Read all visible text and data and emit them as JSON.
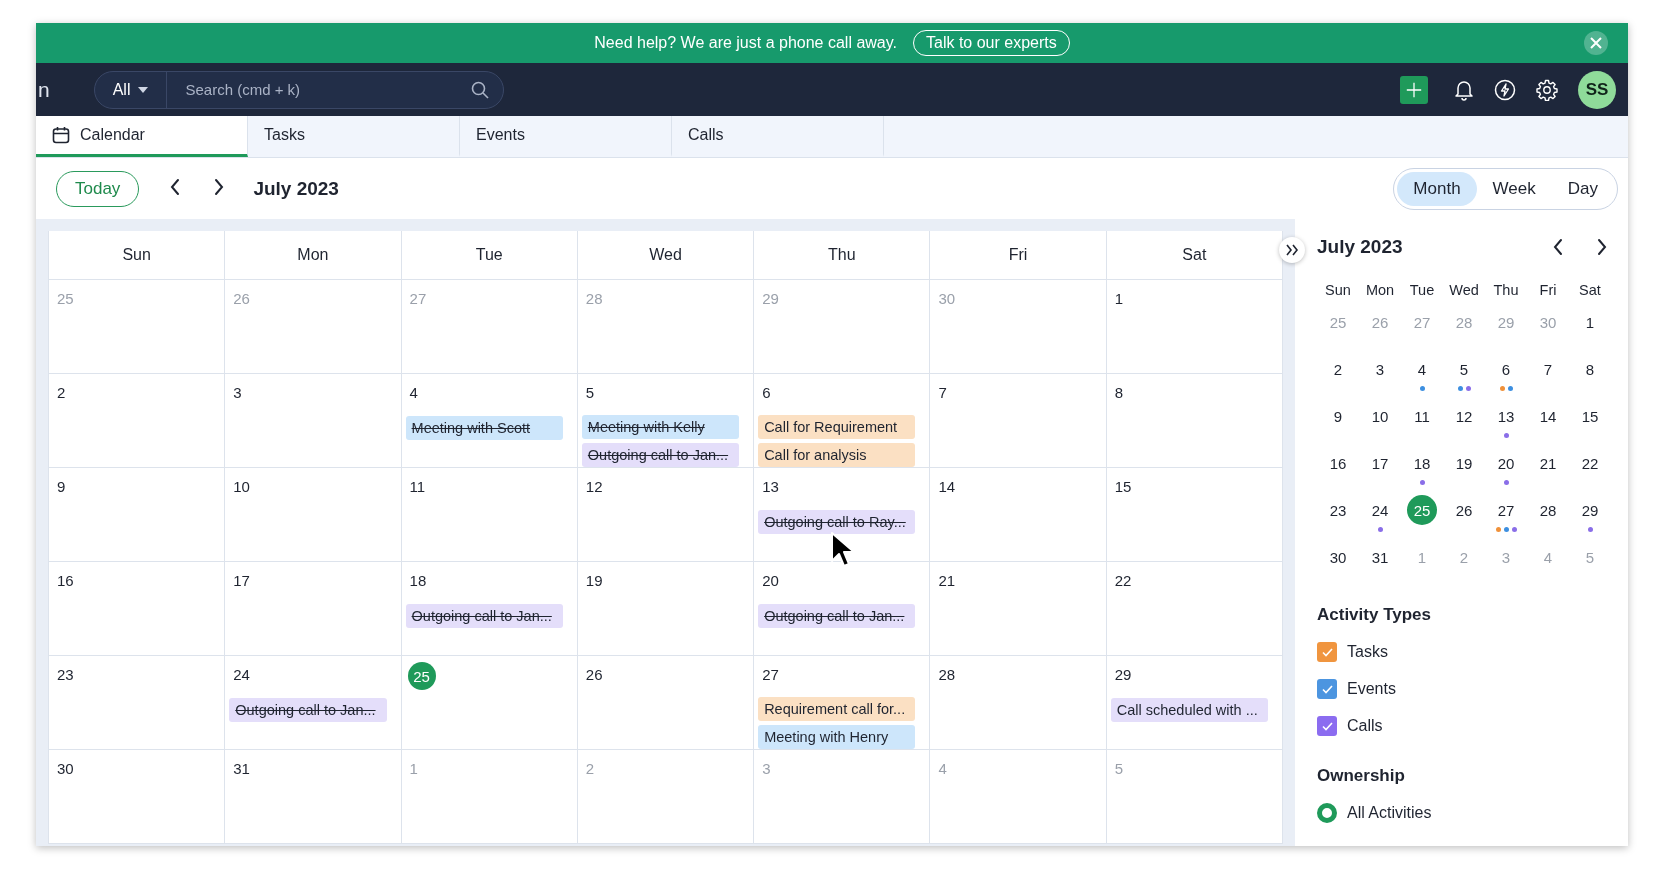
{
  "banner": {
    "message": "Need help? We are just a phone call away.",
    "button": "Talk to our experts"
  },
  "header": {
    "logo_fragment": "n",
    "scope": "All",
    "search": {
      "placeholder": "Search (cmd + k)"
    },
    "avatar": "SS"
  },
  "tabs": [
    {
      "label": "Calendar",
      "selected": true,
      "icon": true
    },
    {
      "label": "Tasks",
      "selected": false
    },
    {
      "label": "Events",
      "selected": false
    },
    {
      "label": "Calls",
      "selected": false
    }
  ],
  "toolbar": {
    "today": "Today",
    "period": "July 2023",
    "views": [
      {
        "label": "Month",
        "selected": true
      },
      {
        "label": "Week",
        "selected": false
      },
      {
        "label": "Day",
        "selected": false
      }
    ]
  },
  "calendar": {
    "weekdays": [
      "Sun",
      "Mon",
      "Tue",
      "Wed",
      "Thu",
      "Fri",
      "Sat"
    ],
    "weeks": [
      [
        {
          "n": "25",
          "muted": true,
          "today": false
        },
        {
          "n": "26",
          "muted": true,
          "today": false
        },
        {
          "n": "27",
          "muted": true,
          "today": false
        },
        {
          "n": "28",
          "muted": true,
          "today": false
        },
        {
          "n": "29",
          "muted": true,
          "today": false
        },
        {
          "n": "30",
          "muted": true,
          "today": false
        },
        {
          "n": "1",
          "muted": false,
          "today": false
        }
      ],
      [
        {
          "n": "2",
          "muted": false,
          "today": false
        },
        {
          "n": "3",
          "muted": false,
          "today": false
        },
        {
          "n": "4",
          "muted": false,
          "today": false,
          "events": [
            {
              "title": "Meeting with Scott",
              "kind": "event",
              "done": true
            }
          ]
        },
        {
          "n": "5",
          "muted": false,
          "today": false,
          "events": [
            {
              "title": "Meeting with Kelly",
              "kind": "event",
              "done": true
            },
            {
              "title": "Outgoing call to Jan...",
              "kind": "call",
              "done": true
            }
          ]
        },
        {
          "n": "6",
          "muted": false,
          "today": false,
          "events": [
            {
              "title": "Call for Requirement",
              "kind": "task",
              "done": false
            },
            {
              "title": "Call for analysis",
              "kind": "task",
              "done": false
            }
          ]
        },
        {
          "n": "7",
          "muted": false,
          "today": false
        },
        {
          "n": "8",
          "muted": false,
          "today": false
        }
      ],
      [
        {
          "n": "9",
          "muted": false,
          "today": false
        },
        {
          "n": "10",
          "muted": false,
          "today": false
        },
        {
          "n": "11",
          "muted": false,
          "today": false
        },
        {
          "n": "12",
          "muted": false,
          "today": false
        },
        {
          "n": "13",
          "muted": false,
          "today": false,
          "events": [
            {
              "title": "Outgoing call to Ray...",
              "kind": "call",
              "done": true
            }
          ]
        },
        {
          "n": "14",
          "muted": false,
          "today": false
        },
        {
          "n": "15",
          "muted": false,
          "today": false
        }
      ],
      [
        {
          "n": "16",
          "muted": false,
          "today": false
        },
        {
          "n": "17",
          "muted": false,
          "today": false
        },
        {
          "n": "18",
          "muted": false,
          "today": false,
          "events": [
            {
              "title": "Outgoing call to Jan...",
              "kind": "call",
              "done": true
            }
          ]
        },
        {
          "n": "19",
          "muted": false,
          "today": false
        },
        {
          "n": "20",
          "muted": false,
          "today": false,
          "events": [
            {
              "title": "Outgoing call to Jan...",
              "kind": "call",
              "done": true
            }
          ]
        },
        {
          "n": "21",
          "muted": false,
          "today": false
        },
        {
          "n": "22",
          "muted": false,
          "today": false
        }
      ],
      [
        {
          "n": "23",
          "muted": false,
          "today": false
        },
        {
          "n": "24",
          "muted": false,
          "today": false,
          "events": [
            {
              "title": "Outgoing call to Jan...",
              "kind": "call",
              "done": true
            }
          ]
        },
        {
          "n": "25",
          "muted": false,
          "today": true
        },
        {
          "n": "26",
          "muted": false,
          "today": false
        },
        {
          "n": "27",
          "muted": false,
          "today": false,
          "events": [
            {
              "title": "Requirement call for...",
              "kind": "task",
              "done": false
            },
            {
              "title": "Meeting with Henry",
              "kind": "event",
              "done": false
            }
          ]
        },
        {
          "n": "28",
          "muted": false,
          "today": false
        },
        {
          "n": "29",
          "muted": false,
          "today": false,
          "events": [
            {
              "title": "Call scheduled with ...",
              "kind": "call",
              "done": false
            }
          ]
        }
      ],
      [
        {
          "n": "30",
          "muted": false,
          "today": false
        },
        {
          "n": "31",
          "muted": false,
          "today": false
        },
        {
          "n": "1",
          "muted": true,
          "today": false
        },
        {
          "n": "2",
          "muted": true,
          "today": false
        },
        {
          "n": "3",
          "muted": true,
          "today": false
        },
        {
          "n": "4",
          "muted": true,
          "today": false
        },
        {
          "n": "5",
          "muted": true,
          "today": false
        }
      ]
    ]
  },
  "mini_calendar": {
    "title": "July 2023",
    "weekdays": [
      "Sun",
      "Mon",
      "Tue",
      "Wed",
      "Thu",
      "Fri",
      "Sat"
    ],
    "weeks": [
      [
        {
          "n": "25",
          "muted": true,
          "today": false
        },
        {
          "n": "26",
          "muted": true,
          "today": false
        },
        {
          "n": "27",
          "muted": true,
          "today": false
        },
        {
          "n": "28",
          "muted": true,
          "today": false
        },
        {
          "n": "29",
          "muted": true,
          "today": false
        },
        {
          "n": "30",
          "muted": true,
          "today": false
        },
        {
          "n": "1",
          "muted": false,
          "today": false
        }
      ],
      [
        {
          "n": "2",
          "muted": false,
          "today": false
        },
        {
          "n": "3",
          "muted": false,
          "today": false
        },
        {
          "n": "4",
          "muted": false,
          "today": false,
          "dots": [
            {
              "color": "#3d8fe0"
            }
          ]
        },
        {
          "n": "5",
          "muted": false,
          "today": false,
          "dots": [
            {
              "color": "#3d8fe0"
            },
            {
              "color": "#8a6ee8"
            }
          ]
        },
        {
          "n": "6",
          "muted": false,
          "today": false,
          "dots": [
            {
              "color": "#f0913a"
            },
            {
              "color": "#3d8fe0"
            }
          ]
        },
        {
          "n": "7",
          "muted": false,
          "today": false
        },
        {
          "n": "8",
          "muted": false,
          "today": false
        }
      ],
      [
        {
          "n": "9",
          "muted": false,
          "today": false
        },
        {
          "n": "10",
          "muted": false,
          "today": false
        },
        {
          "n": "11",
          "muted": false,
          "today": false
        },
        {
          "n": "12",
          "muted": false,
          "today": false
        },
        {
          "n": "13",
          "muted": false,
          "today": false,
          "dots": [
            {
              "color": "#8a6ee8"
            }
          ]
        },
        {
          "n": "14",
          "muted": false,
          "today": false
        },
        {
          "n": "15",
          "muted": false,
          "today": false
        }
      ],
      [
        {
          "n": "16",
          "muted": false,
          "today": false
        },
        {
          "n": "17",
          "muted": false,
          "today": false
        },
        {
          "n": "18",
          "muted": false,
          "today": false,
          "dots": [
            {
              "color": "#8a6ee8"
            }
          ]
        },
        {
          "n": "19",
          "muted": false,
          "today": false
        },
        {
          "n": "20",
          "muted": false,
          "today": false,
          "dots": [
            {
              "color": "#8a6ee8"
            }
          ]
        },
        {
          "n": "21",
          "muted": false,
          "today": false
        },
        {
          "n": "22",
          "muted": false,
          "today": false
        }
      ],
      [
        {
          "n": "23",
          "muted": false,
          "today": false
        },
        {
          "n": "24",
          "muted": false,
          "today": false,
          "dots": [
            {
              "color": "#8a6ee8"
            }
          ]
        },
        {
          "n": "25",
          "muted": false,
          "today": true
        },
        {
          "n": "26",
          "muted": false,
          "today": false
        },
        {
          "n": "27",
          "muted": false,
          "today": false,
          "dots": [
            {
              "color": "#f0913a"
            },
            {
              "color": "#3d8fe0"
            },
            {
              "color": "#8a6ee8"
            }
          ]
        },
        {
          "n": "28",
          "muted": false,
          "today": false
        },
        {
          "n": "29",
          "muted": false,
          "today": false,
          "dots": [
            {
              "color": "#8a6ee8"
            }
          ]
        }
      ],
      [
        {
          "n": "30",
          "muted": false,
          "today": false
        },
        {
          "n": "31",
          "muted": false,
          "today": false
        },
        {
          "n": "1",
          "muted": true,
          "today": false
        },
        {
          "n": "2",
          "muted": true,
          "today": false
        },
        {
          "n": "3",
          "muted": true,
          "today": false
        },
        {
          "n": "4",
          "muted": true,
          "today": false
        },
        {
          "n": "5",
          "muted": true,
          "today": false
        }
      ]
    ]
  },
  "activity_types": {
    "title": "Activity Types",
    "items": [
      {
        "label": "Tasks",
        "checked": true,
        "color": "#f0953f"
      },
      {
        "label": "Events",
        "checked": true,
        "color": "#4c95e0"
      },
      {
        "label": "Calls",
        "checked": true,
        "color": "#8b6cf0"
      }
    ]
  },
  "ownership": {
    "title": "Ownership",
    "options": [
      {
        "label": "All Activities",
        "selected": true
      }
    ]
  }
}
